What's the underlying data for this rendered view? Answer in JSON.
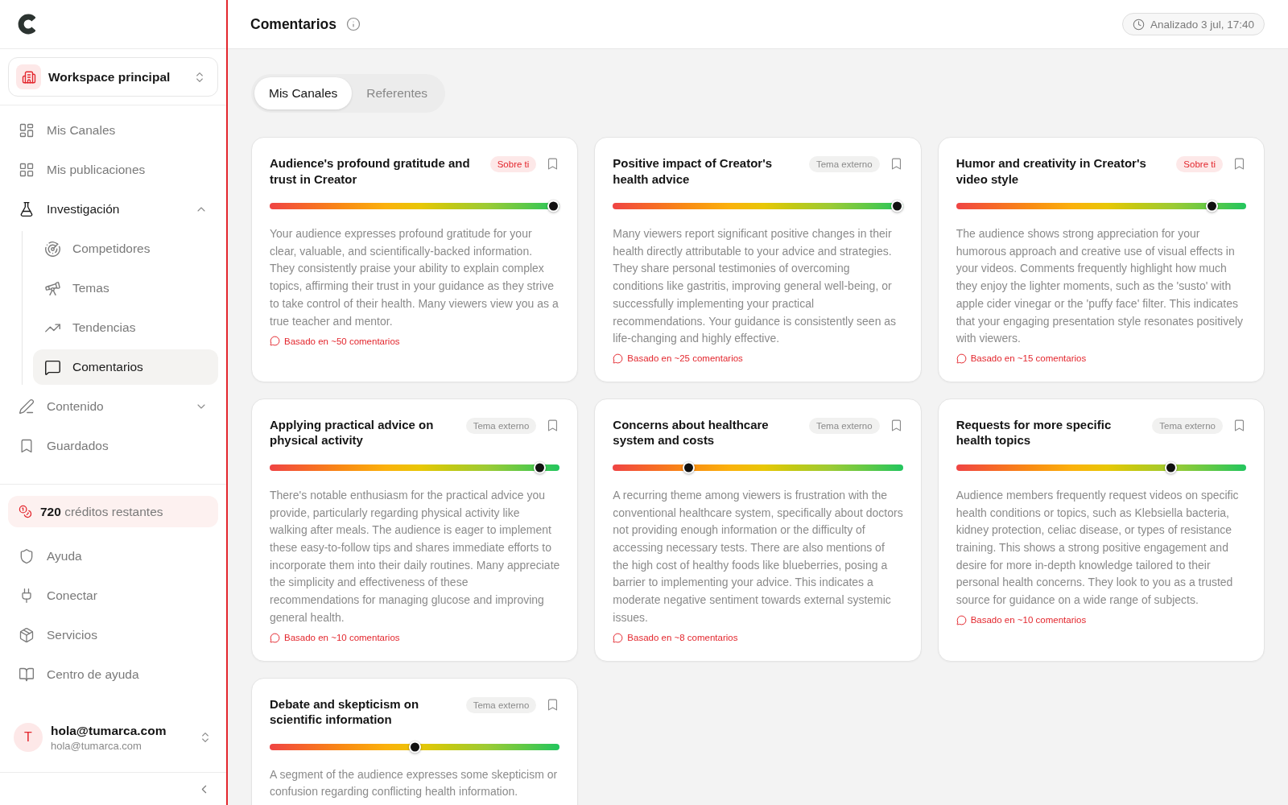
{
  "sidebar": {
    "workspace": {
      "name": "Workspace principal"
    },
    "nav": [
      {
        "label": "Mis Canales",
        "selected": false
      },
      {
        "label": "Mis publicaciones",
        "selected": false
      },
      {
        "label": "Investigación",
        "selected": false,
        "expanded": true,
        "children": [
          {
            "label": "Competidores",
            "selected": false
          },
          {
            "label": "Temas",
            "selected": false
          },
          {
            "label": "Tendencias",
            "selected": false
          },
          {
            "label": "Comentarios",
            "selected": true
          }
        ]
      },
      {
        "label": "Contenido",
        "selected": false,
        "expanded": false
      },
      {
        "label": "Guardados",
        "selected": false
      }
    ],
    "credits": "**720** créditos restantes",
    "links": [
      {
        "label": "Ayuda"
      },
      {
        "label": "Conectar"
      },
      {
        "label": "Servicios"
      },
      {
        "label": "Centro de ayuda"
      }
    ],
    "user": {
      "initial": "T",
      "name": "hola@tumarca.com",
      "email": "hola@tumarca.com"
    }
  },
  "header": {
    "title": "Comentarios",
    "analyzed": "Analizado 3 jul, 17:40"
  },
  "tabs": [
    {
      "label": "Mis Canales",
      "selected": true
    },
    {
      "label": "Referentes",
      "selected": false
    }
  ],
  "cards": [
    {
      "title": "Audience's profound gratitude and trust in Creator",
      "tag": {
        "label": "Sobre ti",
        "kind": "about"
      },
      "level": 1,
      "description": "Your audience expresses profound gratitude for your clear, valuable, and scientifically-backed information. They consistently praise your ability to explain complex topics, affirming their trust in your guidance as they strive to take control of their health. Many viewers view you as a true teacher and mentor.",
      "basis": "Basado en ~50 comentarios"
    },
    {
      "title": "Positive impact of Creator's health advice",
      "tag": {
        "label": "Tema externo",
        "kind": "external"
      },
      "level": 1,
      "description": "Many viewers report significant positive changes in their health directly attributable to your advice and strategies. They share personal testimonies of overcoming conditions like gastritis, improving general well-being, or successfully implementing your practical recommendations. Your guidance is consistently seen as life-changing and highly effective.",
      "basis": "Basado en ~25 comentarios"
    },
    {
      "title": "Humor and creativity in Creator's video style",
      "tag": {
        "label": "Sobre ti",
        "kind": "about"
      },
      "level": 0.9,
      "description": "The audience shows strong appreciation for your humorous approach and creative use of visual effects in your videos. Comments frequently highlight how much they enjoy the lighter moments, such as the 'susto' with apple cider vinegar or the 'puffy face' filter. This indicates that your engaging presentation style resonates positively with viewers.",
      "basis": "Basado en ~15 comentarios"
    },
    {
      "title": "Applying practical advice on physical activity",
      "tag": {
        "label": "Tema externo",
        "kind": "external"
      },
      "level": 0.95,
      "description": "There's notable enthusiasm for the practical advice you provide, particularly regarding physical activity like walking after meals. The audience is eager to implement these easy-to-follow tips and shares immediate efforts to incorporate them into their daily routines. Many appreciate the simplicity and effectiveness of these recommendations for managing glucose and improving general health.",
      "basis": "Basado en ~10 comentarios"
    },
    {
      "title": "Concerns about healthcare system and costs",
      "tag": {
        "label": "Tema externo",
        "kind": "external"
      },
      "level": 0.25,
      "description": "A recurring theme among viewers is frustration with the conventional healthcare system, specifically about doctors not providing enough information or the difficulty of accessing necessary tests. There are also mentions of the high cost of healthy foods like blueberries, posing a barrier to implementing your advice. This indicates a moderate negative sentiment towards external systemic issues.",
      "basis": "Basado en ~8 comentarios"
    },
    {
      "title": "Requests for more specific health topics",
      "tag": {
        "label": "Tema externo",
        "kind": "external"
      },
      "level": 0.75,
      "description": "Audience members frequently request videos on specific health conditions or topics, such as Klebsiella bacteria, kidney protection, celiac disease, or types of resistance training. This shows a strong positive engagement and desire for more in-depth knowledge tailored to their personal health concerns. They look to you as a trusted source for guidance on a wide range of subjects.",
      "basis": "Basado en ~10 comentarios"
    },
    {
      "title": "Debate and skepticism on scientific information",
      "tag": {
        "label": "Tema externo",
        "kind": "external"
      },
      "level": 0.5,
      "description": "A segment of the audience expresses some skepticism or confusion regarding conflicting health information."
    }
  ]
}
